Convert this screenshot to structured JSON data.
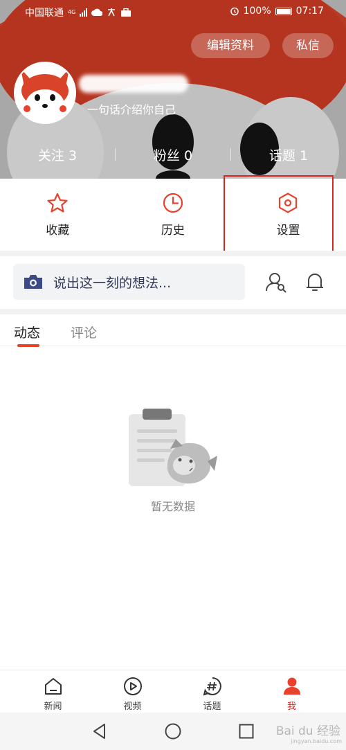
{
  "status_bar": {
    "carrier": "中国联通",
    "network": "4G",
    "battery": "100%",
    "time": "07:17"
  },
  "header": {
    "edit_profile_label": "编辑资料",
    "private_message_label": "私信",
    "bio": "一句话介绍你自己",
    "stats": [
      {
        "label": "关注",
        "count": "3"
      },
      {
        "label": "粉丝",
        "count": "0"
      },
      {
        "label": "话题",
        "count": "1"
      }
    ]
  },
  "quick_actions": [
    {
      "label": "收藏",
      "icon": "star-icon"
    },
    {
      "label": "历史",
      "icon": "clock-icon"
    },
    {
      "label": "设置",
      "icon": "settings-hexagon-icon"
    }
  ],
  "post_bar": {
    "placeholder": "说出这一刻的想法..."
  },
  "tabs": [
    {
      "label": "动态",
      "active": true
    },
    {
      "label": "评论",
      "active": false
    }
  ],
  "empty_state": {
    "text": "暂无数据"
  },
  "bottom_nav": [
    {
      "label": "新闻",
      "icon": "home-icon",
      "active": false
    },
    {
      "label": "视频",
      "icon": "play-icon",
      "active": false
    },
    {
      "label": "话题",
      "icon": "hashtag-icon",
      "active": false
    },
    {
      "label": "我",
      "icon": "person-icon",
      "active": true
    }
  ],
  "watermark": {
    "brand": "Bai du 经验",
    "site": "jingyan.baidu.com"
  },
  "colors": {
    "accent": "#e8412c",
    "highlight_box": "#d9231b",
    "post_icon": "#3b4a86"
  }
}
